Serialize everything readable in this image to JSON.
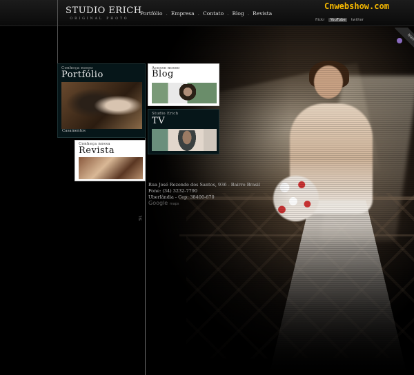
{
  "header": {
    "logo_title": "STUDIO ERICH",
    "logo_subtitle": "ORIGINAL PHOTO",
    "nav": [
      "Portfólio",
      "Empresa",
      "Contato",
      "Blog",
      "Revista"
    ],
    "watermark": "Cnwebshow.com",
    "social": [
      "flickr",
      "YouTube",
      "twitter"
    ],
    "ribbon_text": "NOIVOS"
  },
  "panels": {
    "portfolio": {
      "kicker": "Conheça nosso",
      "title": "Portfólio",
      "caption": "Casamentos"
    },
    "blog": {
      "kicker": "Acesse nosso",
      "title": "Blog"
    },
    "tv": {
      "kicker": "Studio Erich",
      "title": "TV"
    },
    "revista": {
      "kicker": "Conheça nossa",
      "title": "Revista"
    }
  },
  "address": {
    "line1": "Rua José Rezende dos Santos, 936 - Bairro Brasil",
    "line2": "Fone: (34) 3232-7790",
    "line3": "Uberlândia - Cep: 38400-670",
    "maps": "Google",
    "maps_suffix": "maps"
  },
  "side_label": "SIL",
  "colors": {
    "watermark": "#f5b800",
    "panel_bg": "#061619"
  }
}
